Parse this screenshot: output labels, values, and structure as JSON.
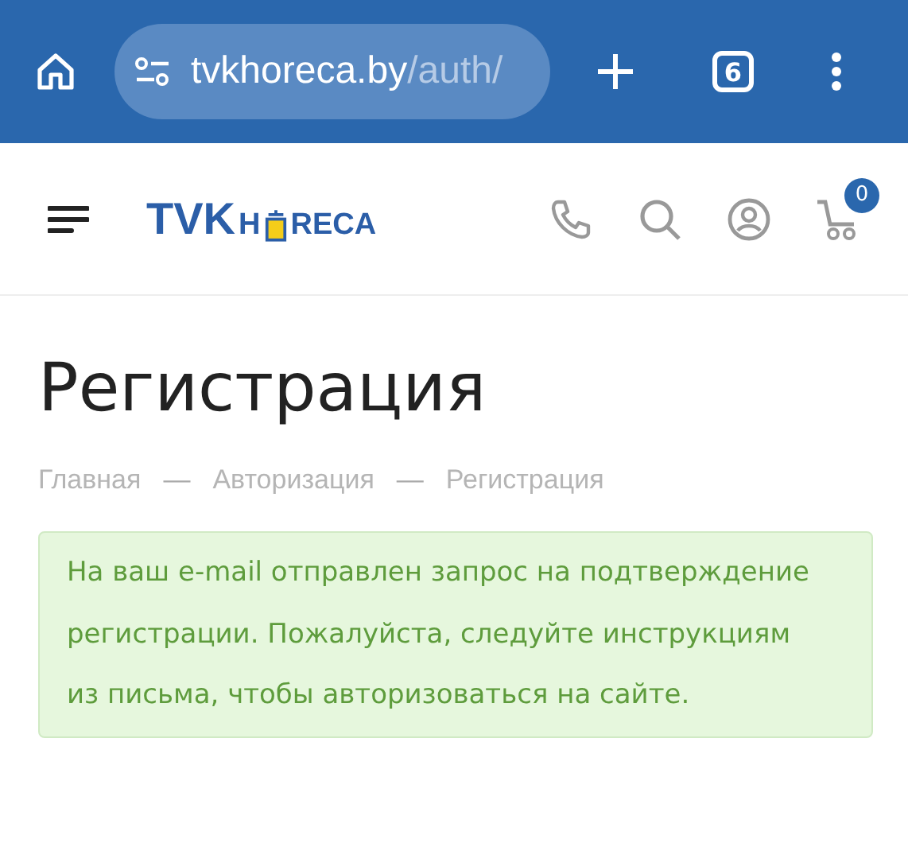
{
  "browser": {
    "url_host": "tvkhoreca.by",
    "url_path": "/auth/",
    "tab_count": "6"
  },
  "header": {
    "logo": {
      "main": "TVK",
      "before_pot": "H",
      "after_pot": "RECA"
    },
    "cart_count": "0"
  },
  "page": {
    "title": "Регистрация",
    "breadcrumbs": [
      {
        "label": "Главная"
      },
      {
        "label": "Авторизация"
      },
      {
        "label": "Регистрация"
      }
    ],
    "separator": "—",
    "message": "На ваш e-mail отправлен запрос на подтверждение регистрации. Пожалуйста, следуйте инструкциям из письма, чтобы авторизоваться на сайте."
  }
}
